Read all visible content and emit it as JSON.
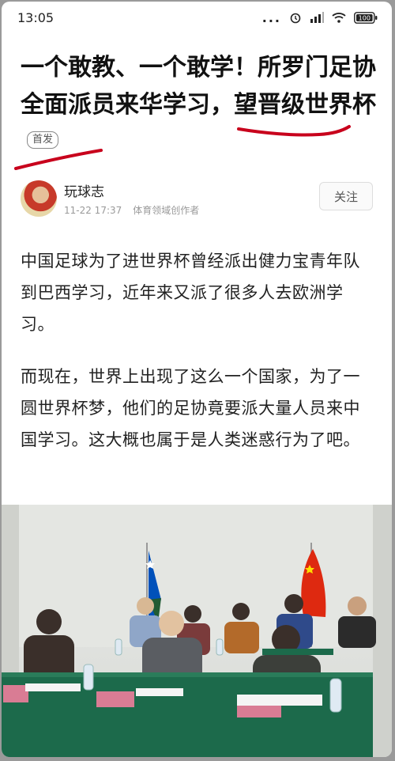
{
  "status_bar": {
    "time": "13:05",
    "dots": "...",
    "battery": "100"
  },
  "article": {
    "title": "一个敢教、一个敢学！所罗门足协全面派员来华学习，望晋级世界杯",
    "badge": "首发",
    "author": {
      "name": "玩球志",
      "time": "11-22 17:37",
      "role": "体育领域创作者"
    },
    "follow_label": "关注",
    "paragraphs": [
      "中国足球为了进世界杯曾经派出健力宝青年队到巴西学习，近年来又派了很多人去欧洲学习。",
      "而现在，世界上出现了这么一个国家，为了一圆世界杯梦，他们的足协竟要派大量人员来中国学习。这大概也属于是人类迷惑行为了吧。"
    ]
  },
  "colors": {
    "red_marker": "#c8001c",
    "table_cloth": "#1c6a4b",
    "flag_china": "#de2910",
    "flag_solomon_blue": "#0051ba"
  }
}
